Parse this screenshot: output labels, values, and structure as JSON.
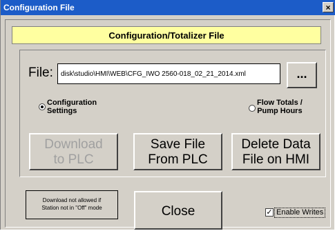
{
  "window": {
    "title": "Configuration File",
    "close_glyph": "×"
  },
  "heading": "Configuration/Totalizer File",
  "file": {
    "label": "File:",
    "value": "disk\\studio\\HMI\\WEB\\CFG_IWO 2560-018_02_21_2014.xml",
    "browse_label": "..."
  },
  "radios": [
    {
      "line1": "Configuration",
      "line2": "Settings",
      "checked": true
    },
    {
      "line1": "Flow Totals /",
      "line2": "Pump Hours",
      "checked": false
    }
  ],
  "buttons": {
    "download": {
      "line1": "Download",
      "line2": "to PLC",
      "enabled": false
    },
    "save": {
      "line1": "Save File",
      "line2": "From PLC"
    },
    "delete": {
      "line1": "Delete Data",
      "line2": "File on HMI"
    },
    "close": "Close"
  },
  "note": {
    "line1": "Download not allowed if",
    "line2": "Station not in \"Off\" mode"
  },
  "enable_writes": {
    "label": "Enable Writes",
    "checked": true,
    "glyph": "✓"
  }
}
